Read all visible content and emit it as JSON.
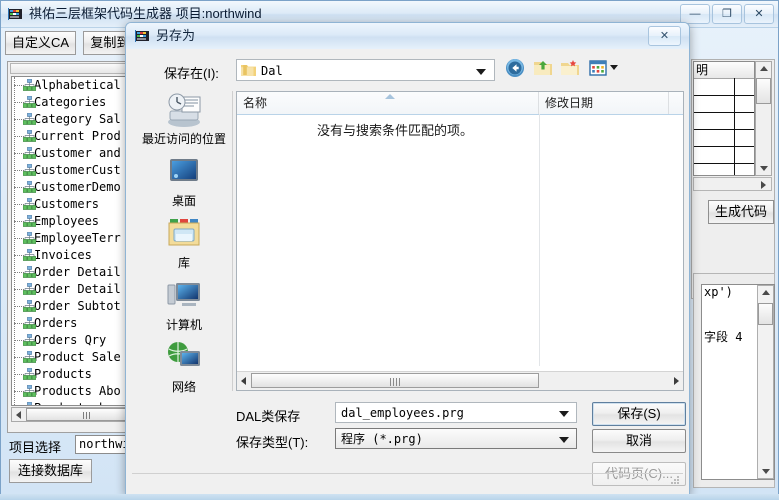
{
  "app": {
    "title": "祺佑三层框架代码生成器 项目:northwind",
    "title_icon": "app-icon",
    "window_buttons": {
      "minimize": "—",
      "maximize": "❐",
      "close": "✕"
    },
    "toolbar": [
      {
        "label": "自定义CA",
        "name": "custom-case-button"
      },
      {
        "label": "复制到剪",
        "name": "copy-to-clipboard-button"
      }
    ],
    "tree": {
      "items": [
        "Alphabetical",
        "Categories",
        "Category Sal",
        "Current Prod",
        "Customer and",
        "CustomerCust",
        "CustomerDemo",
        "Customers",
        "Employees",
        "EmployeeTerr",
        "Invoices",
        "Order Detail",
        "Order Detail",
        "Order Subtot",
        "Orders",
        "Orders Qry",
        "Product Sale",
        "Products",
        "Products Abo",
        "Products by"
      ]
    },
    "project": {
      "label": "项目选择",
      "value": "northwin"
    },
    "connect_button": "连接数据库",
    "generate_code_button": "生成代码",
    "right_grid": {
      "header": "明"
    },
    "code_preview": {
      "line1": "xp')",
      "line2": "字段 4"
    }
  },
  "dialog": {
    "title": "另存为",
    "title_icon": "app-icon",
    "close_label": "✕",
    "save_in": {
      "label": "保存在(I):",
      "value": "Dal",
      "folder_icon": "folder-icon",
      "caret_icon": "chevron-down-icon"
    },
    "nav_icons": [
      {
        "name": "back-icon"
      },
      {
        "name": "up-folder-icon"
      },
      {
        "name": "new-folder-icon"
      },
      {
        "name": "views-icon"
      }
    ],
    "places": [
      {
        "label": "最近访问的位置",
        "icon": "recent-places-icon"
      },
      {
        "label": "桌面",
        "icon": "desktop-icon"
      },
      {
        "label": "库",
        "icon": "libraries-icon"
      },
      {
        "label": "计算机",
        "icon": "computer-icon"
      },
      {
        "label": "网络",
        "icon": "network-icon"
      }
    ],
    "file_list": {
      "columns": [
        "名称",
        "修改日期",
        ""
      ],
      "empty_message": "没有与搜索条件匹配的项。"
    },
    "fields": [
      {
        "label": "DAL类保存",
        "value": "dal_employees.prg"
      },
      {
        "label": "保存类型(T):",
        "value": "程序 (*.prg)"
      }
    ],
    "buttons": {
      "save": "保存(S)",
      "cancel": "取消",
      "codepage": "代码页(C)..."
    }
  },
  "colors": {
    "window_chrome": "#d2e4f5",
    "dialog_face": "#f0f0f0",
    "header_accent": "#b9d3e8",
    "folder_yellow": "#f0c74e"
  }
}
